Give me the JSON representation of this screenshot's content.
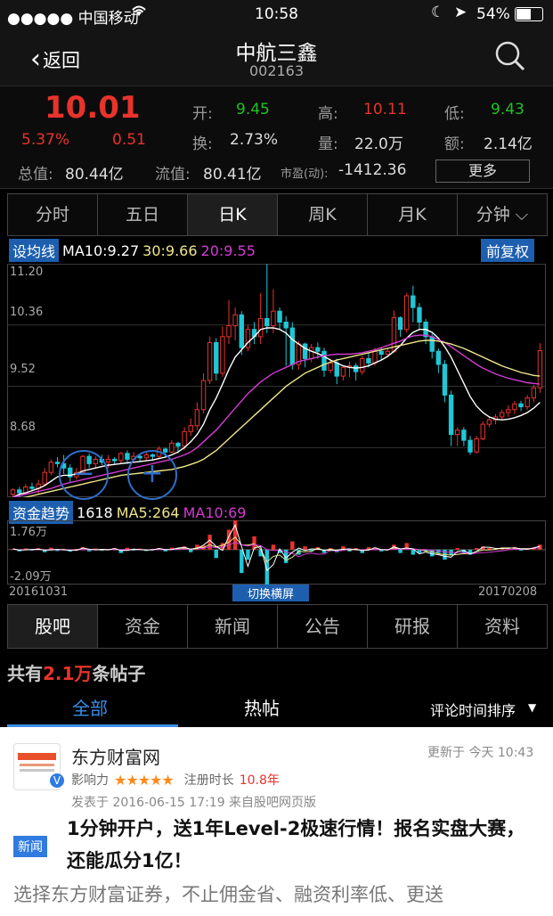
{
  "status_bar": {
    "carrier": "●●●●● 中国移动",
    "time": "10:58",
    "battery": "54%"
  },
  "nav": {
    "back_label": "返回",
    "title": "中航三鑫",
    "code": "002163"
  },
  "quote": {
    "price": "10.01",
    "change_pct": "5.37%",
    "change": "0.51",
    "open_label": "开:",
    "open": "9.45",
    "high_label": "高:",
    "high": "10.11",
    "low_label": "低:",
    "low": "9.43",
    "turnover_label": "换:",
    "turnover": "2.73%",
    "volume_label": "量:",
    "volume": "22.0万",
    "amount_label": "额:",
    "amount": "2.14亿",
    "mktcap_label": "总值:",
    "mktcap": "80.44亿",
    "float_label": "流值:",
    "float": "80.41亿",
    "pe_label": "市盈(动):",
    "pe": "-1412.36",
    "more_label": "更多"
  },
  "period_tabs": [
    {
      "label": "分时"
    },
    {
      "label": "五日"
    },
    {
      "label": "日K"
    },
    {
      "label": "周K"
    },
    {
      "label": "月K"
    },
    {
      "label": "分钟 ⌵"
    }
  ],
  "ma_bar": {
    "set_label": "设均线",
    "ma10": "MA10:9.27",
    "ma30": "30:9.66",
    "ma20": "20:9.55",
    "adjust_label": "前复权"
  },
  "fund_bar": {
    "label": "资金趋势",
    "value": "1618",
    "ma5": "MA5:264",
    "ma10": "MA10:69"
  },
  "colors": {
    "up": "#e8332c",
    "down": "#1fc6d6",
    "ma_white": "#ffffff",
    "ma_yellow": "#f0e68c",
    "ma_magenta": "#d43bd4",
    "accent_blue": "#1d5fae"
  },
  "chart_data": [
    {
      "type": "candlestick",
      "y_ticks": [
        "11.20",
        "10.36",
        "9.52",
        "8.68"
      ],
      "ylim": [
        8.0,
        11.2
      ],
      "x_start": "20161031",
      "x_end": "20170208",
      "candles": [
        [
          8.04,
          8.1,
          7.98,
          8.12
        ],
        [
          8.1,
          8.06,
          8.0,
          8.14
        ],
        [
          8.06,
          8.14,
          8.03,
          8.18
        ],
        [
          8.14,
          8.12,
          8.08,
          8.2
        ],
        [
          8.12,
          8.18,
          8.05,
          8.24
        ],
        [
          8.18,
          8.34,
          8.16,
          8.4
        ],
        [
          8.34,
          8.48,
          8.3,
          8.52
        ],
        [
          8.48,
          8.46,
          8.41,
          8.55
        ],
        [
          8.46,
          8.4,
          8.32,
          8.58
        ],
        [
          8.4,
          8.28,
          8.2,
          8.45
        ],
        [
          8.28,
          8.34,
          8.24,
          8.4
        ],
        [
          8.34,
          8.56,
          8.3,
          8.58
        ],
        [
          8.56,
          8.46,
          8.4,
          8.6
        ],
        [
          8.46,
          8.52,
          8.4,
          8.56
        ],
        [
          8.52,
          8.48,
          8.44,
          8.58
        ],
        [
          8.48,
          8.52,
          8.4,
          8.58
        ],
        [
          8.52,
          8.5,
          8.45,
          8.55
        ],
        [
          8.5,
          8.6,
          8.46,
          8.62
        ],
        [
          8.6,
          8.52,
          8.46,
          8.64
        ],
        [
          8.52,
          8.56,
          8.5,
          8.62
        ],
        [
          8.56,
          8.54,
          8.48,
          8.6
        ],
        [
          8.54,
          8.58,
          8.5,
          8.62
        ],
        [
          8.58,
          8.56,
          8.5,
          8.6
        ],
        [
          8.56,
          8.66,
          8.52,
          8.7
        ],
        [
          8.66,
          8.62,
          8.55,
          8.68
        ],
        [
          8.62,
          8.74,
          8.6,
          8.78
        ],
        [
          8.74,
          8.7,
          8.6,
          8.76
        ],
        [
          8.7,
          8.9,
          8.65,
          8.96
        ],
        [
          8.9,
          8.98,
          8.84,
          9.08
        ],
        [
          8.98,
          9.2,
          8.92,
          9.3
        ],
        [
          9.2,
          9.6,
          9.15,
          9.7
        ],
        [
          9.6,
          10.12,
          9.55,
          10.2
        ],
        [
          10.12,
          9.7,
          9.6,
          10.18
        ],
        [
          9.7,
          10.2,
          9.65,
          10.34
        ],
        [
          10.2,
          10.35,
          10.1,
          10.7
        ],
        [
          10.35,
          10.5,
          10.15,
          10.6
        ],
        [
          10.5,
          10.05,
          9.95,
          10.55
        ],
        [
          10.05,
          10.3,
          10.0,
          10.36
        ],
        [
          10.3,
          10.2,
          10.1,
          10.4
        ],
        [
          10.2,
          10.45,
          10.1,
          10.8
        ],
        [
          10.45,
          10.35,
          10.25,
          11.24
        ],
        [
          10.35,
          10.55,
          10.25,
          10.85
        ],
        [
          10.55,
          10.4,
          10.3,
          10.6
        ],
        [
          10.4,
          10.32,
          9.8,
          10.48
        ],
        [
          10.32,
          9.82,
          9.75,
          10.4
        ],
        [
          9.82,
          10.1,
          9.75,
          10.14
        ],
        [
          10.1,
          9.9,
          9.78,
          10.12
        ],
        [
          9.9,
          10.05,
          9.85,
          10.1
        ],
        [
          10.05,
          10.0,
          9.9,
          10.12
        ],
        [
          10.0,
          9.74,
          9.65,
          10.05
        ],
        [
          9.74,
          9.84,
          9.7,
          9.9
        ],
        [
          9.84,
          9.66,
          9.55,
          9.9
        ],
        [
          9.66,
          9.78,
          9.6,
          9.8
        ],
        [
          9.78,
          9.8,
          9.65,
          9.86
        ],
        [
          9.8,
          9.72,
          9.6,
          9.84
        ],
        [
          9.72,
          9.9,
          9.68,
          9.94
        ],
        [
          9.9,
          9.84,
          9.78,
          9.98
        ],
        [
          9.84,
          10.0,
          9.8,
          10.05
        ],
        [
          10.0,
          9.96,
          9.88,
          10.05
        ],
        [
          9.96,
          10.0,
          9.92,
          10.05
        ],
        [
          10.0,
          10.46,
          9.98,
          10.56
        ],
        [
          10.46,
          10.3,
          10.2,
          10.48
        ],
        [
          10.3,
          10.76,
          10.26,
          10.8
        ],
        [
          10.76,
          10.6,
          10.4,
          10.9
        ],
        [
          10.6,
          10.4,
          10.3,
          10.66
        ],
        [
          10.4,
          10.2,
          10.1,
          10.44
        ],
        [
          10.2,
          10.0,
          9.9,
          10.24
        ],
        [
          10.0,
          9.82,
          9.7,
          10.04
        ],
        [
          9.82,
          9.4,
          9.3,
          9.88
        ],
        [
          9.4,
          8.86,
          8.7,
          9.46
        ],
        [
          8.86,
          8.92,
          8.7,
          8.96
        ],
        [
          8.92,
          8.78,
          8.7,
          8.96
        ],
        [
          8.78,
          8.62,
          8.58,
          8.84
        ],
        [
          8.62,
          8.8,
          8.6,
          8.84
        ],
        [
          8.8,
          9.0,
          8.78,
          9.04
        ],
        [
          9.0,
          9.06,
          8.96,
          9.1
        ],
        [
          9.06,
          9.1,
          9.0,
          9.14
        ],
        [
          9.1,
          9.16,
          9.06,
          9.2
        ],
        [
          9.16,
          9.2,
          9.1,
          9.26
        ],
        [
          9.2,
          9.28,
          9.14,
          9.32
        ],
        [
          9.28,
          9.24,
          9.18,
          9.32
        ],
        [
          9.24,
          9.36,
          9.2,
          9.4
        ],
        [
          9.36,
          9.5,
          9.3,
          9.54
        ],
        [
          9.5,
          10.01,
          9.43,
          10.11
        ]
      ],
      "ma_series": [
        {
          "name": "MA10",
          "color": "#ffffff",
          "values": [
            8.0,
            8.04,
            8.06,
            8.09,
            8.12,
            8.16,
            8.22,
            8.28,
            8.3,
            8.3,
            8.32,
            8.36,
            8.38,
            8.4,
            8.42,
            8.44,
            8.45,
            8.46,
            8.47,
            8.48,
            8.49,
            8.5,
            8.51,
            8.53,
            8.55,
            8.58,
            8.62,
            8.68,
            8.76,
            8.86,
            9.0,
            9.2,
            9.36,
            9.55,
            9.75,
            9.92,
            10.02,
            10.12,
            10.2,
            10.3,
            10.32,
            10.32,
            10.3,
            10.25,
            10.16,
            10.1,
            10.04,
            10.0,
            9.97,
            9.93,
            9.88,
            9.84,
            9.8,
            9.78,
            9.77,
            9.78,
            9.8,
            9.84,
            9.88,
            9.93,
            10.0,
            10.08,
            10.18,
            10.26,
            10.3,
            10.3,
            10.26,
            10.18,
            10.06,
            9.92,
            9.74,
            9.56,
            9.38,
            9.25,
            9.16,
            9.1,
            9.07,
            9.06,
            9.07,
            9.09,
            9.12,
            9.16,
            9.22,
            9.3
          ]
        },
        {
          "name": "MA20",
          "color": "#d43bd4",
          "values": [
            8.0,
            8.02,
            8.04,
            8.06,
            8.08,
            8.1,
            8.12,
            8.15,
            8.18,
            8.2,
            8.22,
            8.24,
            8.26,
            8.28,
            8.3,
            8.32,
            8.34,
            8.36,
            8.38,
            8.4,
            8.42,
            8.44,
            8.46,
            8.48,
            8.5,
            8.52,
            8.55,
            8.58,
            8.62,
            8.68,
            8.76,
            8.84,
            8.92,
            9.02,
            9.12,
            9.22,
            9.32,
            9.42,
            9.5,
            9.58,
            9.64,
            9.7,
            9.74,
            9.78,
            9.82,
            9.86,
            9.88,
            9.9,
            9.92,
            9.94,
            9.95,
            9.96,
            9.96,
            9.96,
            9.97,
            9.98,
            10.0,
            10.02,
            10.05,
            10.08,
            10.11,
            10.14,
            10.18,
            10.21,
            10.22,
            10.22,
            10.2,
            10.16,
            10.12,
            10.06,
            10.0,
            9.94,
            9.88,
            9.82,
            9.77,
            9.73,
            9.69,
            9.66,
            9.63,
            9.61,
            9.59,
            9.57,
            9.56,
            9.55
          ]
        },
        {
          "name": "MA30",
          "color": "#f0e68c",
          "values": [
            7.96,
            7.98,
            8.0,
            8.02,
            8.04,
            8.06,
            8.08,
            8.1,
            8.12,
            8.14,
            8.16,
            8.18,
            8.2,
            8.22,
            8.24,
            8.26,
            8.28,
            8.3,
            8.31,
            8.32,
            8.33,
            8.34,
            8.35,
            8.36,
            8.37,
            8.38,
            8.4,
            8.42,
            8.45,
            8.48,
            8.52,
            8.58,
            8.64,
            8.72,
            8.8,
            8.88,
            8.96,
            9.04,
            9.12,
            9.2,
            9.28,
            9.36,
            9.44,
            9.52,
            9.58,
            9.64,
            9.7,
            9.74,
            9.78,
            9.82,
            9.85,
            9.88,
            9.9,
            9.92,
            9.94,
            9.96,
            9.98,
            10.0,
            10.02,
            10.04,
            10.06,
            10.08,
            10.1,
            10.12,
            10.14,
            10.15,
            10.15,
            10.14,
            10.12,
            10.1,
            10.07,
            10.04,
            10.0,
            9.96,
            9.92,
            9.88,
            9.84,
            9.8,
            9.77,
            9.74,
            9.71,
            9.69,
            9.67,
            9.66
          ]
        }
      ]
    },
    {
      "type": "bar",
      "title": "资金趋势",
      "y_ticks": [
        "1.76万",
        "-2.09万"
      ],
      "ylim": [
        -2.09,
        1.76
      ],
      "values": [
        0.05,
        -0.1,
        0.08,
        -0.05,
        0.1,
        -0.15,
        0.12,
        -0.08,
        0.06,
        -0.12,
        0.05,
        0.15,
        -0.1,
        0.08,
        -0.06,
        0.04,
        0.1,
        -0.2,
        0.12,
        -0.05,
        0.06,
        -0.08,
        0.05,
        0.1,
        -0.1,
        0.12,
        0.08,
        0.2,
        -0.15,
        0.3,
        0.25,
        0.9,
        -0.5,
        0.4,
        1.2,
        1.76,
        -1.4,
        -0.6,
        0.8,
        -0.4,
        -2.09,
        0.3,
        -0.2,
        -0.8,
        0.5,
        -0.3,
        0.2,
        -0.1,
        0.15,
        -0.2,
        0.1,
        -0.15,
        0.2,
        -0.1,
        0.1,
        -0.2,
        0.15,
        0.1,
        -0.1,
        0.05,
        0.3,
        -0.2,
        0.4,
        -0.3,
        -0.2,
        -0.1,
        -0.4,
        -0.2,
        -0.6,
        -0.3,
        0.1,
        -0.2,
        -0.3,
        0.1,
        0.2,
        0.1,
        0.05,
        0.1,
        0.08,
        0.15,
        -0.05,
        0.1,
        0.12,
        0.3
      ]
    }
  ],
  "switch_label": "切换横屏",
  "bottom_tabs": [
    {
      "label": "股吧"
    },
    {
      "label": "资金"
    },
    {
      "label": "新闻"
    },
    {
      "label": "公告"
    },
    {
      "label": "研报"
    },
    {
      "label": "资料"
    }
  ],
  "forum": {
    "count_prefix": "共有",
    "count": "2.1万",
    "count_suffix": "条帖子",
    "tab_all": "全部",
    "tab_hot": "热帖",
    "sort_label": "评论时间排序"
  },
  "post": {
    "author": "东方财富网",
    "influence_label": "影响力",
    "stars": "★★★★★",
    "reg_label": "注册时长",
    "reg_value": "10.8年",
    "updated": "更新于 今天 10:43",
    "published": "发表于 2016-06-15 17:19  来自股吧网页版",
    "badge": "新闻",
    "title": "1分钟开户，送1年Level-2极速行情！报名实盘大赛，还能瓜分1亿！",
    "excerpt": "选择东方财富证券，不止佣金省、融资利率低、更送"
  }
}
